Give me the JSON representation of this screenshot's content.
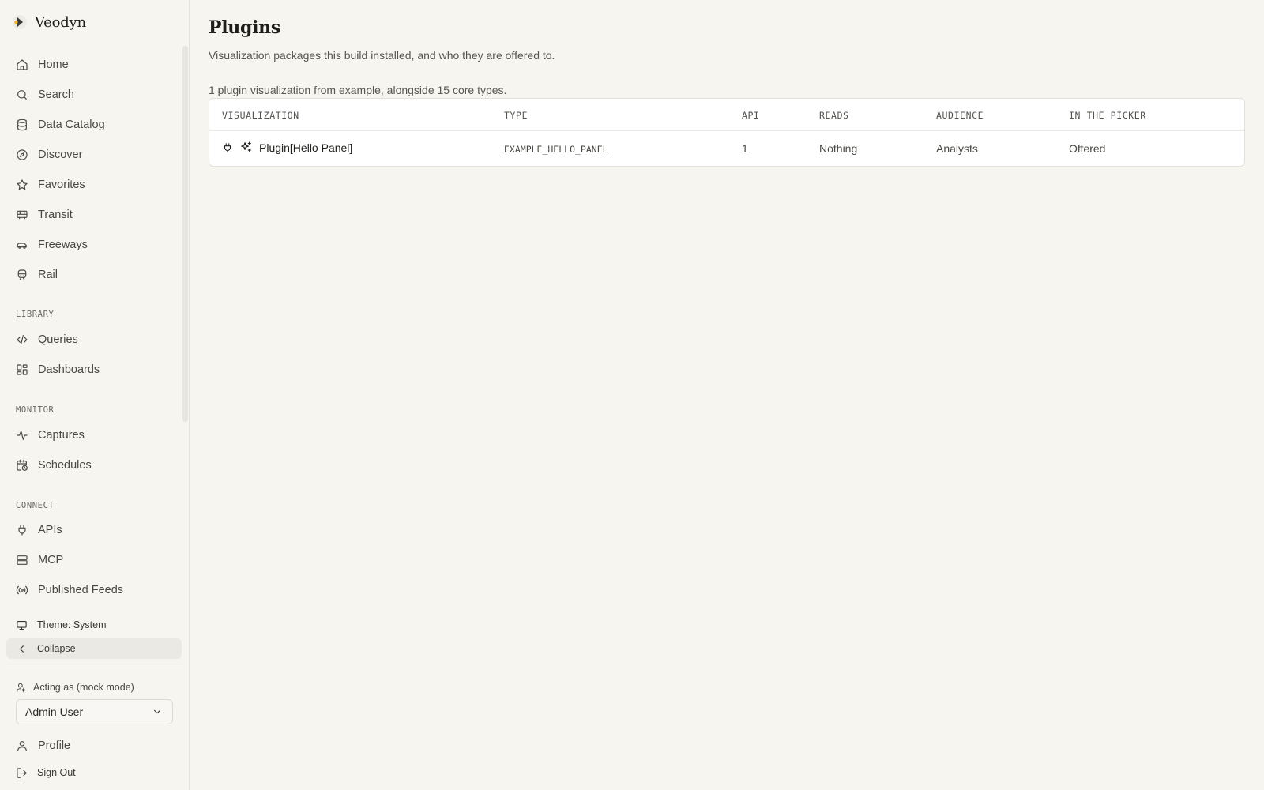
{
  "app": {
    "name": "Veodyn"
  },
  "nav": {
    "main": [
      {
        "label": "Home",
        "icon": "home-icon"
      },
      {
        "label": "Search",
        "icon": "search-icon"
      },
      {
        "label": "Data Catalog",
        "icon": "database-icon"
      },
      {
        "label": "Discover",
        "icon": "compass-icon"
      },
      {
        "label": "Favorites",
        "icon": "star-icon"
      },
      {
        "label": "Transit",
        "icon": "bus-icon"
      },
      {
        "label": "Freeways",
        "icon": "car-icon"
      },
      {
        "label": "Rail",
        "icon": "train-icon"
      }
    ],
    "library_label": "LIBRARY",
    "library": [
      {
        "label": "Queries",
        "icon": "code-icon"
      },
      {
        "label": "Dashboards",
        "icon": "dashboard-icon"
      }
    ],
    "monitor_label": "MONITOR",
    "monitor": [
      {
        "label": "Captures",
        "icon": "activity-icon"
      },
      {
        "label": "Schedules",
        "icon": "calendar-clock-icon"
      }
    ],
    "connect_label": "CONNECT",
    "connect": [
      {
        "label": "APIs",
        "icon": "plug-icon"
      },
      {
        "label": "MCP",
        "icon": "server-icon"
      },
      {
        "label": "Published Feeds",
        "icon": "broadcast-icon"
      }
    ],
    "theme_label": "Theme: System",
    "collapse_label": "Collapse",
    "acting_as_label": "Acting as (mock mode)",
    "acting_as_value": "Admin User",
    "profile_label": "Profile",
    "signout_label": "Sign Out"
  },
  "page": {
    "title": "Plugins",
    "subtitle": "Visualization packages this build installed, and who they are offered to.",
    "summary": "1 plugin visualization from example, alongside 15 core types."
  },
  "table": {
    "headers": [
      "VISUALIZATION",
      "TYPE",
      "API",
      "READS",
      "AUDIENCE",
      "IN THE PICKER"
    ],
    "rows": [
      {
        "visualization": "Plugin[Hello Panel]",
        "type": "EXAMPLE_HELLO_PANEL",
        "api": "1",
        "reads": "Nothing",
        "audience": "Analysts",
        "picker": "Offered"
      }
    ]
  },
  "colors": {
    "accent": "#f0b323",
    "background": "#f6f5f0"
  }
}
